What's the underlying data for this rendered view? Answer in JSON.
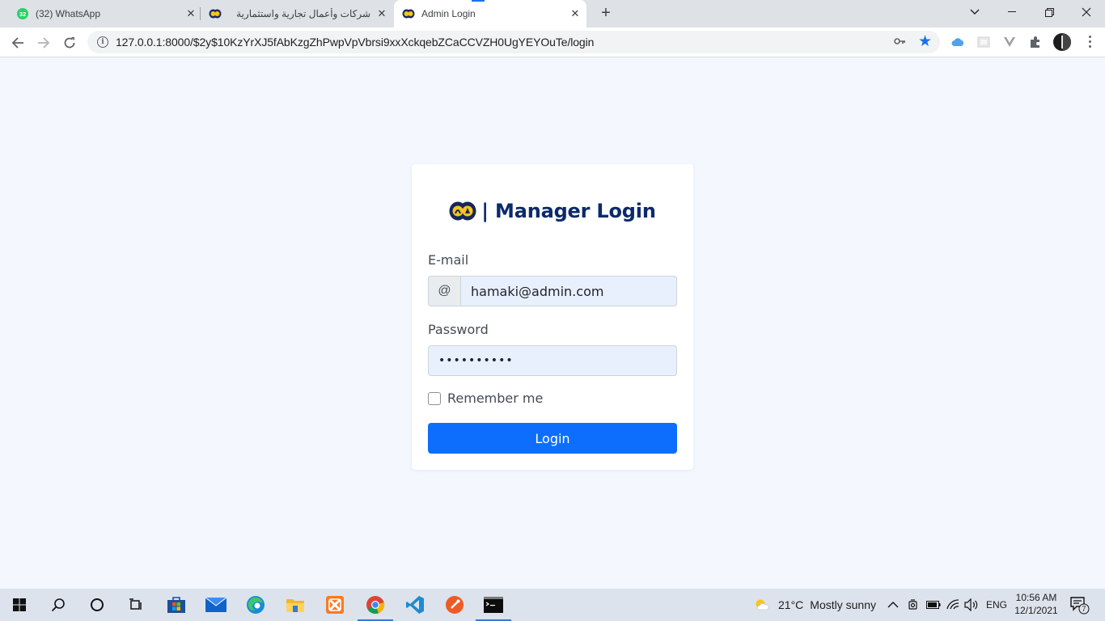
{
  "browser": {
    "tabs": [
      {
        "title": "(32) WhatsApp",
        "badge": "32",
        "favicon": "whatsapp-icon",
        "active": false
      },
      {
        "title": "شركات وأعمال تجارية واستثمارية",
        "favicon": "site-logo-icon",
        "active": false
      },
      {
        "title": "Admin Login",
        "favicon": "site-logo-icon",
        "active": true
      }
    ],
    "new_tab": "+",
    "url": "127.0.0.1:8000/$2y$10KzYrXJ5fAbKzgZhPwpVpVbrsi9xxXckqebZCaCCVZH0UgYEYOuTe/login",
    "accent_color": "#1a73e8"
  },
  "login": {
    "heading": "| Manager Login",
    "email_label": "E-mail",
    "email_addon": "@",
    "email_value": "hamaki@admin.com",
    "password_label": "Password",
    "password_value": "••••••••••",
    "remember_label": "Remember me",
    "remember_checked": false,
    "submit_label": "Login",
    "colors": {
      "heading": "#0c2a6b",
      "button": "#0d6efd",
      "input_fill": "#e8f0fe",
      "page_bg": "#f4f7fe"
    }
  },
  "taskbar": {
    "apps": [
      "windows-start-icon",
      "search-icon",
      "cortana-icon",
      "task-view-icon",
      "microsoft-store-icon",
      "mail-icon",
      "edge-icon",
      "file-explorer-icon",
      "xampp-icon",
      "chrome-icon",
      "vscode-icon",
      "postman-icon",
      "terminal-icon"
    ],
    "weather_temp": "21°C",
    "weather_text": "Mostly sunny",
    "language": "ENG",
    "time": "10:56 AM",
    "date": "12/1/2021",
    "notification_count": "7"
  }
}
